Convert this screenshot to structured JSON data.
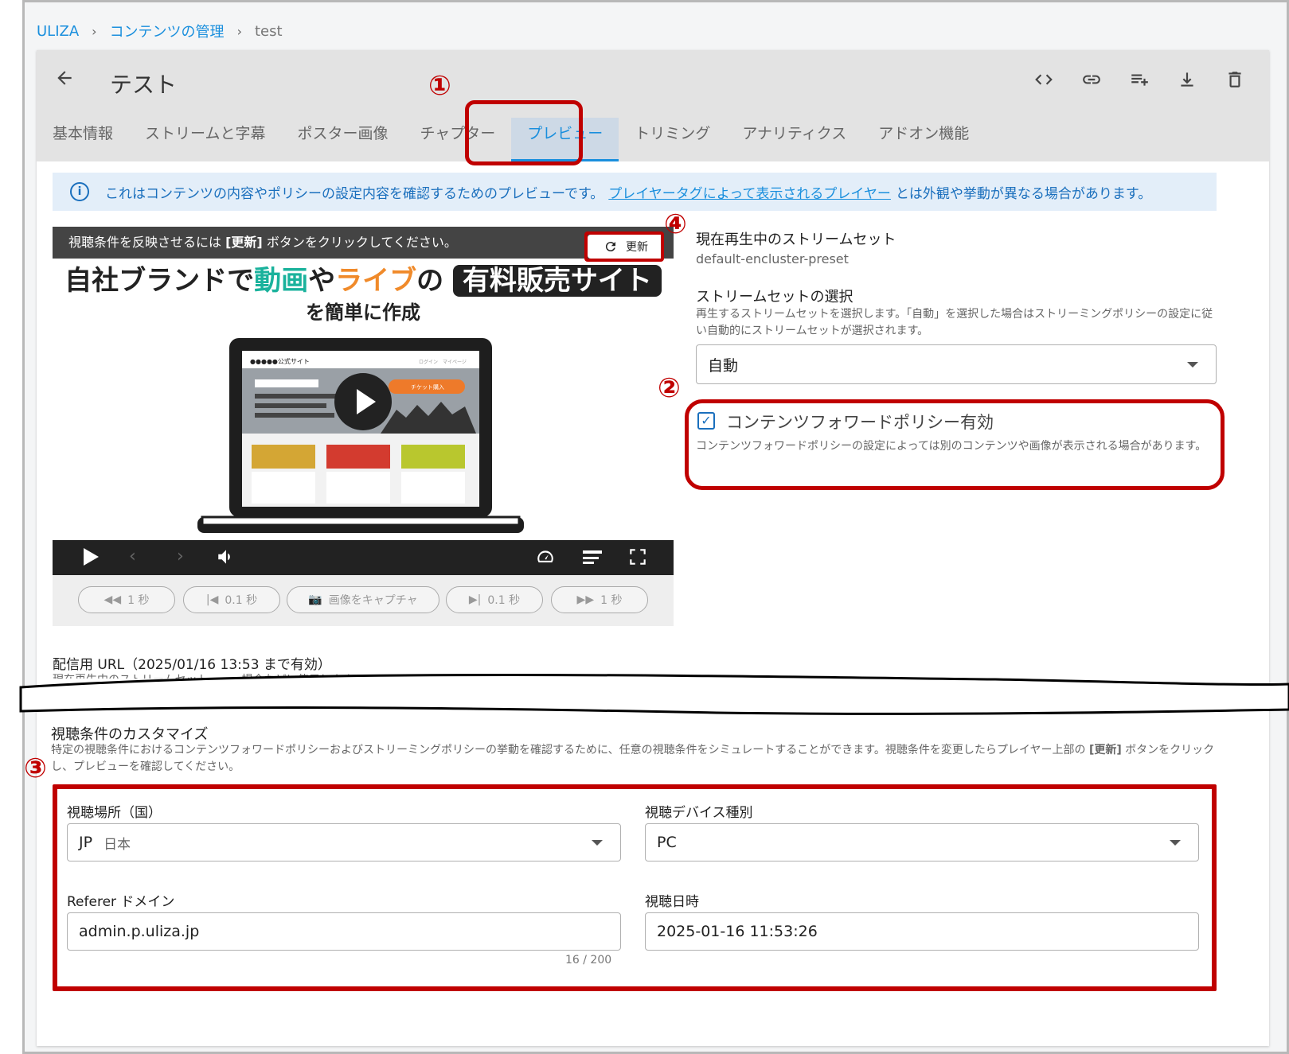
{
  "breadcrumb": {
    "root": "ULIZA",
    "sep": "›",
    "parent": "コンテンツの管理",
    "current": "test"
  },
  "page": {
    "back_icon": "arrow-left-icon",
    "title": "テスト"
  },
  "toolbar": [
    "code-icon",
    "link-icon",
    "playlist-add-icon",
    "download-icon",
    "delete-icon"
  ],
  "tabs": [
    "基本情報",
    "ストリームと字幕",
    "ポスター画像",
    "チャプター",
    "プレビュー",
    "トリミング",
    "アナリティクス",
    "アドオン機能"
  ],
  "active_tab": "プレビュー",
  "info": {
    "text1": "これはコンテンツの内容やポリシーの設定内容を確認するためのプレビューです。",
    "link": "プレイヤータグによって表示されるプレイヤー",
    "text2": "とは外観や挙動が異なる場合があります。"
  },
  "player": {
    "banner_pre": "視聴条件を反映させるには ",
    "banner_bold": "[更新]",
    "banner_post": " ボタンをクリックしてください。",
    "refresh_label": "更新",
    "ad_part1": "自社ブランドで",
    "ad_part2": "動画",
    "ad_part3": "や",
    "ad_part4": "ライブ",
    "ad_part5": "の",
    "ad_part6": "有料販売サイト",
    "ad_line2": "を簡単に作成",
    "screen_logo": "●●●●●公式サイト",
    "screen_nav": "ログイン　マイページ",
    "screen_ticket": "チケット購入",
    "controls": [
      "play-icon",
      "prev-icon",
      "next-icon",
      "volume-icon",
      "speed-icon",
      "settings-icon",
      "fullscreen-icon"
    ]
  },
  "steps": [
    {
      "icon": "rewind-icon",
      "label": "1 秒"
    },
    {
      "icon": "frame-back-icon",
      "label": "0.1 秒"
    },
    {
      "icon": "camera-icon",
      "label": "画像をキャプチャ"
    },
    {
      "icon": "frame-forward-icon",
      "label": "0.1 秒"
    },
    {
      "icon": "fast-forward-icon",
      "label": "1 秒"
    }
  ],
  "stream": {
    "current_label": "現在再生中のストリームセット",
    "current_value": "default-encluster-preset",
    "select_label": "ストリームセットの選択",
    "select_desc": "再生するストリームセットを選択します。「自動」を選択した場合はストリーミングポリシーの設定に従い自動的にストリームセットが選択されます。",
    "select_value": "自動"
  },
  "forward_policy": {
    "checked": true,
    "label": "コンテンツフォワードポリシー有効",
    "desc": "コンテンツフォワードポリシーの設定によっては別のコンテンツや画像が表示される場合があります。"
  },
  "url": {
    "label": "配信用 URL（2025/01/16 13:53 まで有効）",
    "desc_fragment": "現在再生中のストリームセット…　…場合などに使用します"
  },
  "customize": {
    "title": "視聴条件のカスタマイズ",
    "desc_pre": "特定の視聴条件におけるコンテンツフォワードポリシーおよびストリーミングポリシーの挙動を確認するために、任意の視聴条件をシミュレートすることができます。視聴条件を変更したらプレイヤー上部の ",
    "desc_bold": "[更新]",
    "desc_post": " ボタンをクリックし、プレビューを確認してください。",
    "location_label": "視聴場所（国）",
    "location_code": "JP",
    "location_name": "日本",
    "device_label": "視聴デバイス種別",
    "device_value": "PC",
    "referer_label": "Referer ドメイン",
    "referer_value": "admin.p.uliza.jp",
    "referer_count": "16 / 200",
    "datetime_label": "視聴日時",
    "datetime_value": "2025-01-16 11:53:26"
  },
  "annotations": {
    "n1": "①",
    "n2": "②",
    "n3": "③",
    "n4": "④"
  },
  "colors": {
    "accent": "#1a8fdd",
    "annotation": "#c00000",
    "header_bg": "#e3e3e3",
    "info_bg": "#e3eef9"
  }
}
